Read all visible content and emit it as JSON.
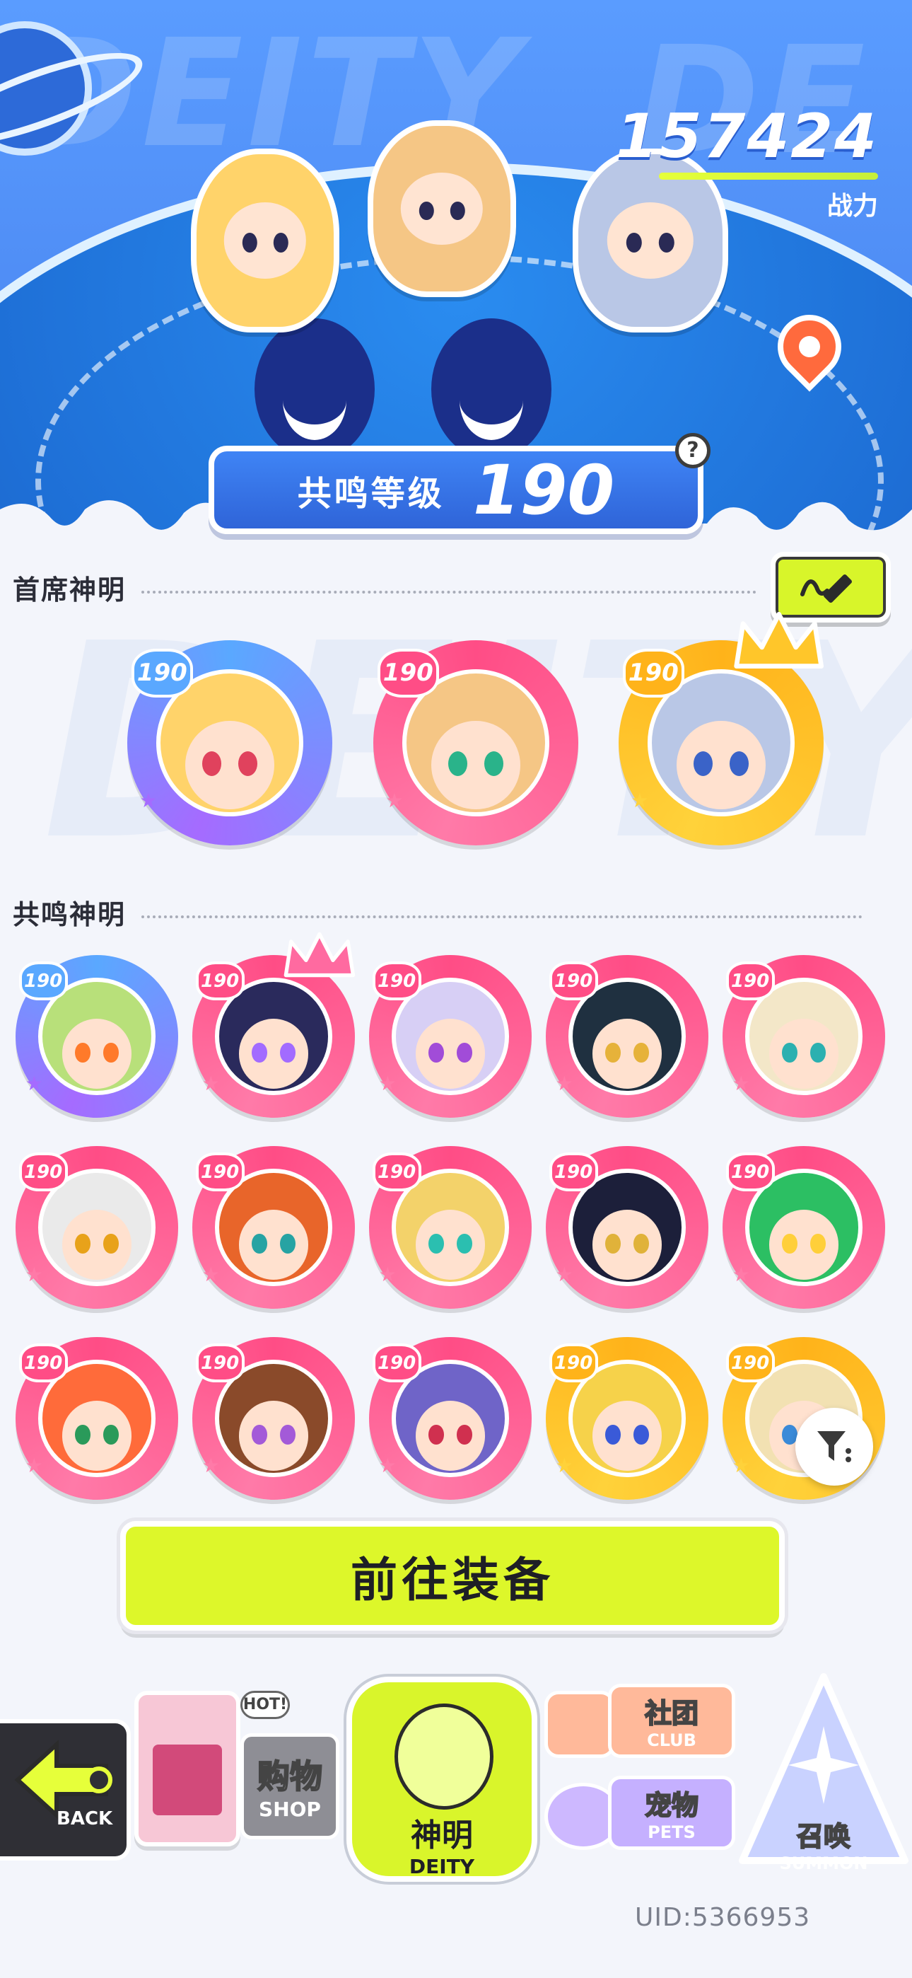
{
  "header": {
    "bg_text": "DEITY",
    "power_value": "157424",
    "power_label": "战力",
    "resonance_label": "共鸣等级",
    "resonance_level": "190",
    "help_icon": "?"
  },
  "sections": {
    "chief_title": "首席神明",
    "resonance_title": "共鸣神明",
    "bg_text": "DEITY"
  },
  "chief_deities": [
    {
      "level": "190",
      "frame": "#5aa8ff",
      "frame2": "#a56bff",
      "hair": "#ffd36a",
      "eye": "#e0425d"
    },
    {
      "level": "190",
      "frame": "#ff4d86",
      "frame2": "#ff7aa8",
      "hair": "#f5c685",
      "eye": "#2ab38a"
    },
    {
      "level": "190",
      "frame": "#ffb31a",
      "frame2": "#ffd23a",
      "hair": "#b9c7e6",
      "eye": "#3a63c8"
    }
  ],
  "resonance_deities": [
    {
      "level": "190",
      "frame": "#5aa8ff",
      "frame2": "#a56bff",
      "hair": "#b8e07a",
      "eye": "#ff7a2a"
    },
    {
      "level": "190",
      "frame": "#ff4d86",
      "frame2": "#ff7aa8",
      "hair": "#2a2a5c",
      "eye": "#a26bff"
    },
    {
      "level": "190",
      "frame": "#ff4d86",
      "frame2": "#ff7aa8",
      "hair": "#d7cff5",
      "eye": "#a14cd8"
    },
    {
      "level": "190",
      "frame": "#ff4d86",
      "frame2": "#ff7aa8",
      "hair": "#1f3040",
      "eye": "#e6b23a"
    },
    {
      "level": "190",
      "frame": "#ff4d86",
      "frame2": "#ff7aa8",
      "hair": "#f3e7c8",
      "eye": "#2bb0b0"
    },
    {
      "level": "190",
      "frame": "#ff4d86",
      "frame2": "#ff7aa8",
      "hair": "#eaeaea",
      "eye": "#e8a21a"
    },
    {
      "level": "190",
      "frame": "#ff4d86",
      "frame2": "#ff7aa8",
      "hair": "#e8652a",
      "eye": "#27a3a3"
    },
    {
      "level": "190",
      "frame": "#ff4d86",
      "frame2": "#ff7aa8",
      "hair": "#f3d26a",
      "eye": "#2bbfb0"
    },
    {
      "level": "190",
      "frame": "#ff4d86",
      "frame2": "#ff7aa8",
      "hair": "#1c1f3a",
      "eye": "#e0b23a"
    },
    {
      "level": "190",
      "frame": "#ff4d86",
      "frame2": "#ff7aa8",
      "hair": "#2cbf63",
      "eye": "#ffcf3a"
    },
    {
      "level": "190",
      "frame": "#ff4d86",
      "frame2": "#ff7aa8",
      "hair": "#ff6b3a",
      "eye": "#2a9a5a"
    },
    {
      "level": "190",
      "frame": "#ff4d86",
      "frame2": "#ff7aa8",
      "hair": "#8a4a2a",
      "eye": "#a35ad8"
    },
    {
      "level": "190",
      "frame": "#ff4d86",
      "frame2": "#ff7aa8",
      "hair": "#6f64c8",
      "eye": "#d0304f"
    },
    {
      "level": "190",
      "frame": "#ffb31a",
      "frame2": "#ffd23a",
      "hair": "#f6d24a",
      "eye": "#3a5ad8"
    },
    {
      "level": "190",
      "frame": "#ffb31a",
      "frame2": "#ffd23a",
      "hair": "#f2e1b2",
      "eye": "#3a8ad8"
    }
  ],
  "cta": {
    "label": "前往装备"
  },
  "nav": {
    "back_label": "BACK",
    "shop_cn": "购物",
    "shop_en": "SHOP",
    "shop_badge": "HOT!",
    "deity_cn": "神明",
    "deity_en": "DEITY",
    "club_cn": "社团",
    "club_en": "CLUB",
    "pets_cn": "宠物",
    "pets_en": "PETS",
    "summon_cn": "召唤",
    "summon_en": "SUMMON"
  },
  "uid": "UID:5366953",
  "colors": {
    "accent_lime": "#ddf72a",
    "hero_blue": "#4f8df5",
    "pink_frame": "#ff4d86",
    "gold_frame": "#ffb31a"
  }
}
